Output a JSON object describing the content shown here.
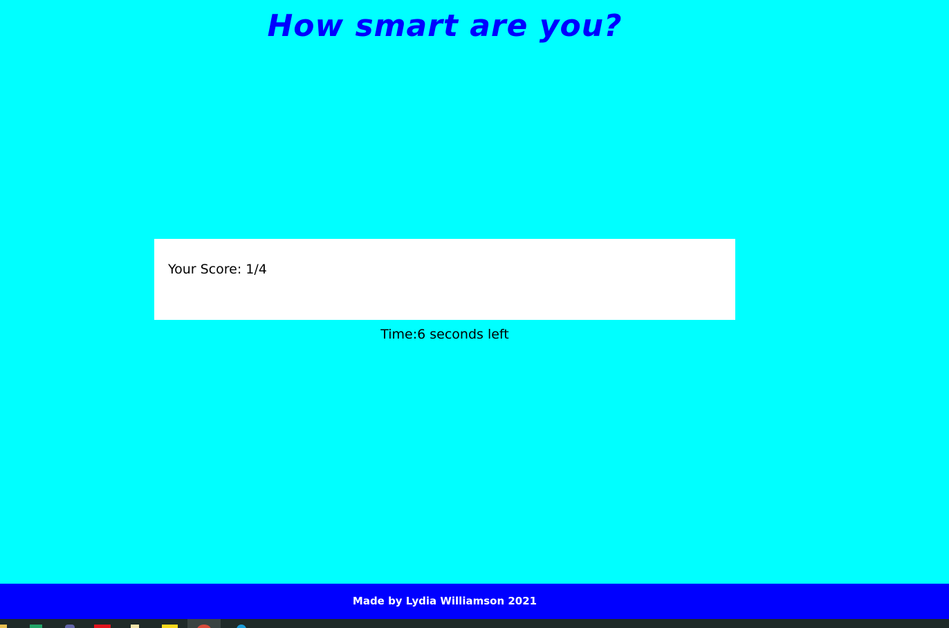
{
  "header": {
    "title": "How smart are you?"
  },
  "score_card": {
    "score_text": "Your Score: 1/4"
  },
  "timer": {
    "text": "Time:6 seconds left"
  },
  "footer": {
    "credit": "Made by Lydia Williamson 2021"
  },
  "colors": {
    "background": "#00ffff",
    "title": "#0000ff",
    "footer_bg": "#0000ff",
    "footer_text": "#ffffff",
    "card_bg": "#ffffff",
    "taskbar_bg": "#1f2a28"
  },
  "taskbar": {
    "icons": [
      "file-explorer-icon",
      "spreadsheet-app-icon",
      "teams-app-icon",
      "pdf-app-icon",
      "notes-app-icon",
      "sticky-notes-icon",
      "chrome-browser-icon",
      "edge-browser-icon"
    ]
  }
}
